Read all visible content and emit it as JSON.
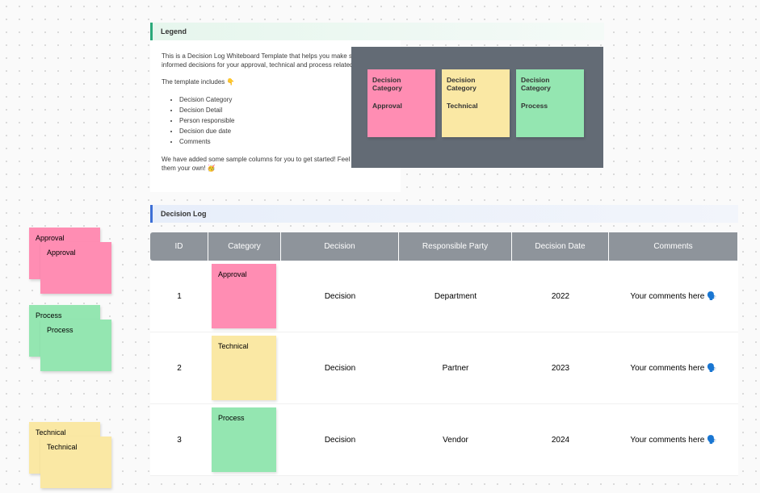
{
  "legend": {
    "title": "Legend",
    "intro": "This is a Decision Log Whiteboard Template that helps you make smarter, informed decisions for your approval, technical and process related changes.",
    "includes_label": "The template includes 👇",
    "bullets": [
      "Decision Category",
      "Decision Detail",
      "Person responsible",
      "Decision due date",
      "Comments"
    ],
    "footer": "We have added some sample columns for you to get started! Feel free to make them your own! 🥳"
  },
  "categories": {
    "title_label": "Decision Category",
    "items": [
      {
        "name": "Approval",
        "color": "pink"
      },
      {
        "name": "Technical",
        "color": "yellow"
      },
      {
        "name": "Process",
        "color": "green"
      }
    ]
  },
  "side": [
    {
      "label": "Approval",
      "color": "pink"
    },
    {
      "label": "Process",
      "color": "green"
    },
    {
      "label": "Technical",
      "color": "yellow"
    }
  ],
  "log": {
    "title": "Decision Log",
    "columns": [
      "ID",
      "Category",
      "Decision",
      "Responsible Party",
      "Decision Date",
      "Comments"
    ],
    "rows": [
      {
        "id": "1",
        "category": "Approval",
        "cat_color": "pink",
        "decision": "Decision",
        "party": "Department",
        "date": "2022",
        "comments": "Your comments here 🗣️"
      },
      {
        "id": "2",
        "category": "Technical",
        "cat_color": "yellow",
        "decision": "Decision",
        "party": "Partner",
        "date": "2023",
        "comments": "Your comments here 🗣️"
      },
      {
        "id": "3",
        "category": "Process",
        "cat_color": "green",
        "decision": "Decision",
        "party": "Vendor",
        "date": "2024",
        "comments": "Your comments here 🗣️"
      }
    ]
  }
}
